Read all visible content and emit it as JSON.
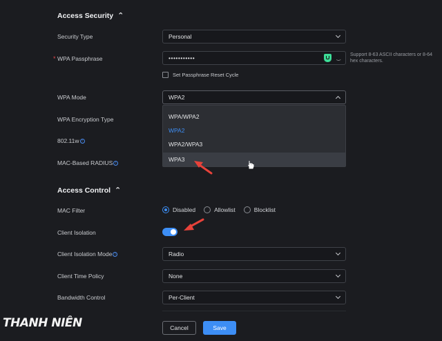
{
  "access_security": {
    "title": "Access Security",
    "security_type": {
      "label": "Security Type",
      "value": "Personal"
    },
    "wpa_passphrase": {
      "label": "WPA Passphrase",
      "required_mark": "*",
      "value": "•••••••••••",
      "hint": "Support 8-63 ASCII characters or 8-64 hex characters."
    },
    "reset_cycle": {
      "label": "Set Passphrase Reset Cycle",
      "checked": false
    },
    "wpa_mode": {
      "label": "WPA Mode",
      "value": "WPA2",
      "options": [
        "WPA/WPA2",
        "WPA2",
        "WPA2/WPA3",
        "WPA3"
      ],
      "selected": "WPA2",
      "hovered": "WPA3"
    },
    "encryption_type": {
      "label": "WPA Encryption Type"
    },
    "dot11w": {
      "label": "802.11w"
    },
    "mac_radius": {
      "label": "MAC-Based RADIUS"
    }
  },
  "access_control": {
    "title": "Access Control",
    "mac_filter": {
      "label": "MAC Filter",
      "options": [
        "Disabled",
        "Allowlist",
        "Blocklist"
      ],
      "selected": "Disabled"
    },
    "client_isolation": {
      "label": "Client Isolation",
      "enabled": true
    },
    "client_isolation_mode": {
      "label": "Client Isolation Mode",
      "value": "Radio"
    },
    "client_time_policy": {
      "label": "Client Time Policy",
      "value": "None"
    },
    "bandwidth_control": {
      "label": "Bandwidth Control",
      "value": "Per-Client"
    }
  },
  "buttons": {
    "cancel": "Cancel",
    "save": "Save"
  },
  "watermark": "THANH NIÊN",
  "colors": {
    "accent": "#3d8ef5",
    "annotation_arrow": "#e8423a",
    "passphrase_strength": "#3ddc97"
  }
}
